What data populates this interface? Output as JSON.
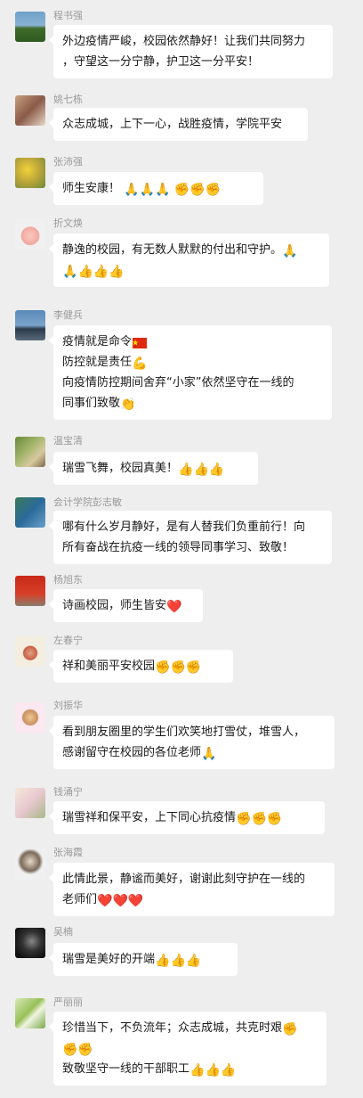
{
  "messages": [
    {
      "sender": "程书强",
      "lines": [
        "外边疫情严峻，校园依然静好！让我们共同努力",
        "，守望这一分宁静，护卫这一分平安！"
      ],
      "emoji": []
    },
    {
      "sender": "姚七栋",
      "lines": [
        "众志成城，上下一心，战胜疫情，学院平安"
      ],
      "emoji": []
    },
    {
      "sender": "张沛强",
      "lines": [
        "师生安康！"
      ],
      "emoji": [
        "folded-hands",
        "folded-hands",
        "folded-hands",
        "fist",
        "fist",
        "fist"
      ]
    },
    {
      "sender": "折文焕",
      "lines": [
        "静逸的校园，有无数人默默的付出和守护。"
      ],
      "emoji": [
        "folded-hands",
        "folded-hands",
        "thumbs-up",
        "thumbs-up",
        "thumbs-up"
      ]
    },
    {
      "sender": "李健兵",
      "lines": [
        "疫情就是命令",
        "防控就是责任",
        "向疫情防控期间舍弃“小家”依然坚守在一线的",
        "同事们致敬"
      ],
      "emoji": [
        "flag",
        "muscle",
        "clap"
      ]
    },
    {
      "sender": "温宝清",
      "lines": [
        "瑞雪飞舞，校园真美！"
      ],
      "emoji": [
        "thumbs-up",
        "thumbs-up",
        "thumbs-up"
      ]
    },
    {
      "sender": "会计学院彭志敏",
      "lines": [
        "哪有什么岁月静好，是有人替我们负重前行！向",
        "所有奋战在抗疫一线的领导同事学习、致敬！"
      ],
      "emoji": []
    },
    {
      "sender": "杨旭东",
      "lines": [
        "诗画校园，师生皆安"
      ],
      "emoji": [
        "heart"
      ]
    },
    {
      "sender": "左春宁",
      "lines": [
        "祥和美丽平安校园"
      ],
      "emoji": [
        "fist",
        "fist",
        "fist"
      ]
    },
    {
      "sender": "刘振华",
      "lines": [
        "看到朋友圈里的学生们欢笑地打雪仗，堆雪人，",
        "感谢留守在校园的各位老师"
      ],
      "emoji": [
        "folded-hands"
      ]
    },
    {
      "sender": "钱涌宁",
      "lines": [
        "瑞雪祥和保平安，上下同心抗疫情"
      ],
      "emoji": [
        "fist",
        "fist",
        "fist"
      ]
    },
    {
      "sender": "张海霞",
      "lines": [
        "此情此景，静谧而美好，谢谢此刻守护在一线的",
        "老师们"
      ],
      "emoji": [
        "heart",
        "heart",
        "heart"
      ]
    },
    {
      "sender": "吴楠",
      "lines": [
        "瑞雪是美好的开端"
      ],
      "emoji": [
        "thumbs-up",
        "thumbs-up",
        "thumbs-up"
      ]
    },
    {
      "sender": "严丽丽",
      "lines": [
        "珍惜当下，不负流年；众志成城，共克时艰",
        "",
        "致敬坚守一线的干部职工"
      ],
      "emoji": [
        "fist",
        "fist",
        "fist",
        "thumbs-up",
        "thumbs-up",
        "thumbs-up"
      ]
    }
  ]
}
